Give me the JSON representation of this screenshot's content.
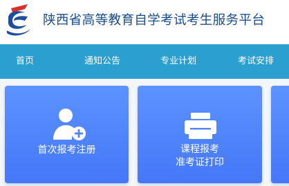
{
  "header": {
    "title": "陕西省高等教育自学考试考生服务平台"
  },
  "nav": {
    "items": [
      {
        "label": "首页"
      },
      {
        "label": "通知公告"
      },
      {
        "label": "专业计划"
      },
      {
        "label": "考试安排"
      }
    ]
  },
  "cards": [
    {
      "label": "首次报考注册",
      "icon": "user-add-icon"
    },
    {
      "label_line1": "课程报考",
      "label_line2": "准考证打印",
      "icon": "printer-icon"
    }
  ],
  "colors": {
    "nav_background": "#2b9fd0",
    "card_background": "#4f84fc",
    "title_text": "#1b4c8a",
    "logo_red": "#d8312b",
    "logo_blue": "#1f4f9c"
  }
}
